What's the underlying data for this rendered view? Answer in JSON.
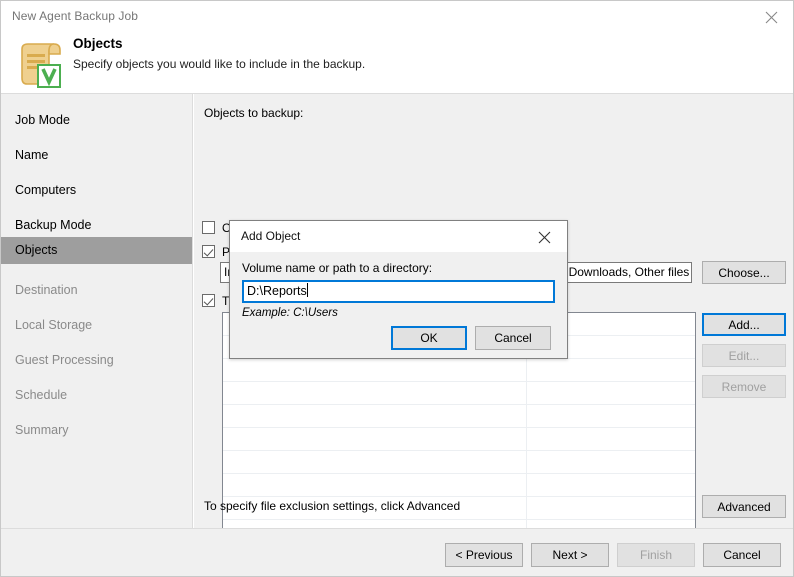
{
  "window": {
    "title": "New Agent Backup Job",
    "close_icon": "close-icon"
  },
  "header": {
    "title": "Objects",
    "subtitle": "Specify objects you would like to include in the backup.",
    "icon": "scroll-document-veeam-icon"
  },
  "sidebar": {
    "items": [
      {
        "label": "Job Mode",
        "state": "visited"
      },
      {
        "label": "Name",
        "state": "visited"
      },
      {
        "label": "Computers",
        "state": "visited"
      },
      {
        "label": "Backup Mode",
        "state": "visited"
      },
      {
        "label": "Objects",
        "state": "selected"
      },
      {
        "label": "Destination",
        "state": "disabled"
      },
      {
        "label": "Local Storage",
        "state": "disabled"
      },
      {
        "label": "Guest Processing",
        "state": "disabled"
      },
      {
        "label": "Schedule",
        "state": "disabled"
      },
      {
        "label": "Summary",
        "state": "disabled"
      }
    ]
  },
  "main": {
    "section_label": "Objects to backup:",
    "checkboxes": [
      {
        "label": "Operating system",
        "checked": false
      },
      {
        "label": "Personal files",
        "checked": true
      },
      {
        "label": "The following file system objects:",
        "checked": true
      }
    ],
    "include_field": {
      "value": "Include: Desktop, Documents, Pictures, Video, Music, Favorites, Downloads, Other files ar"
    },
    "buttons": {
      "choose": {
        "label": "Choose...",
        "enabled": true,
        "focused": false
      },
      "add": {
        "label": "Add...",
        "enabled": true,
        "focused": true
      },
      "edit": {
        "label": "Edit...",
        "enabled": false,
        "focused": false
      },
      "remove": {
        "label": "Remove",
        "enabled": false,
        "focused": false
      },
      "advanced": {
        "label": "Advanced",
        "enabled": true,
        "focused": false
      }
    },
    "list": {
      "rows": [],
      "empty_row_count": 11
    },
    "hint": "To specify file exclusion settings, click Advanced"
  },
  "footer": {
    "previous": {
      "label": "< Previous",
      "enabled": true
    },
    "next": {
      "label": "Next >",
      "enabled": true
    },
    "finish": {
      "label": "Finish",
      "enabled": false
    },
    "cancel": {
      "label": "Cancel",
      "enabled": true
    }
  },
  "dialog": {
    "title": "Add Object",
    "close_icon": "close-icon",
    "prompt": "Volume name or path to a directory:",
    "input_value": "D:\\Reports",
    "example": "Example: C:\\Users",
    "ok": "OK",
    "cancel": "Cancel"
  },
  "colors": {
    "accent": "#0078d7",
    "sidebar_bg": "#f0f0f0",
    "selected_nav": "#9e9e9e",
    "veeam_green": "#4caf50",
    "icon_gold": "#e8c06a"
  }
}
